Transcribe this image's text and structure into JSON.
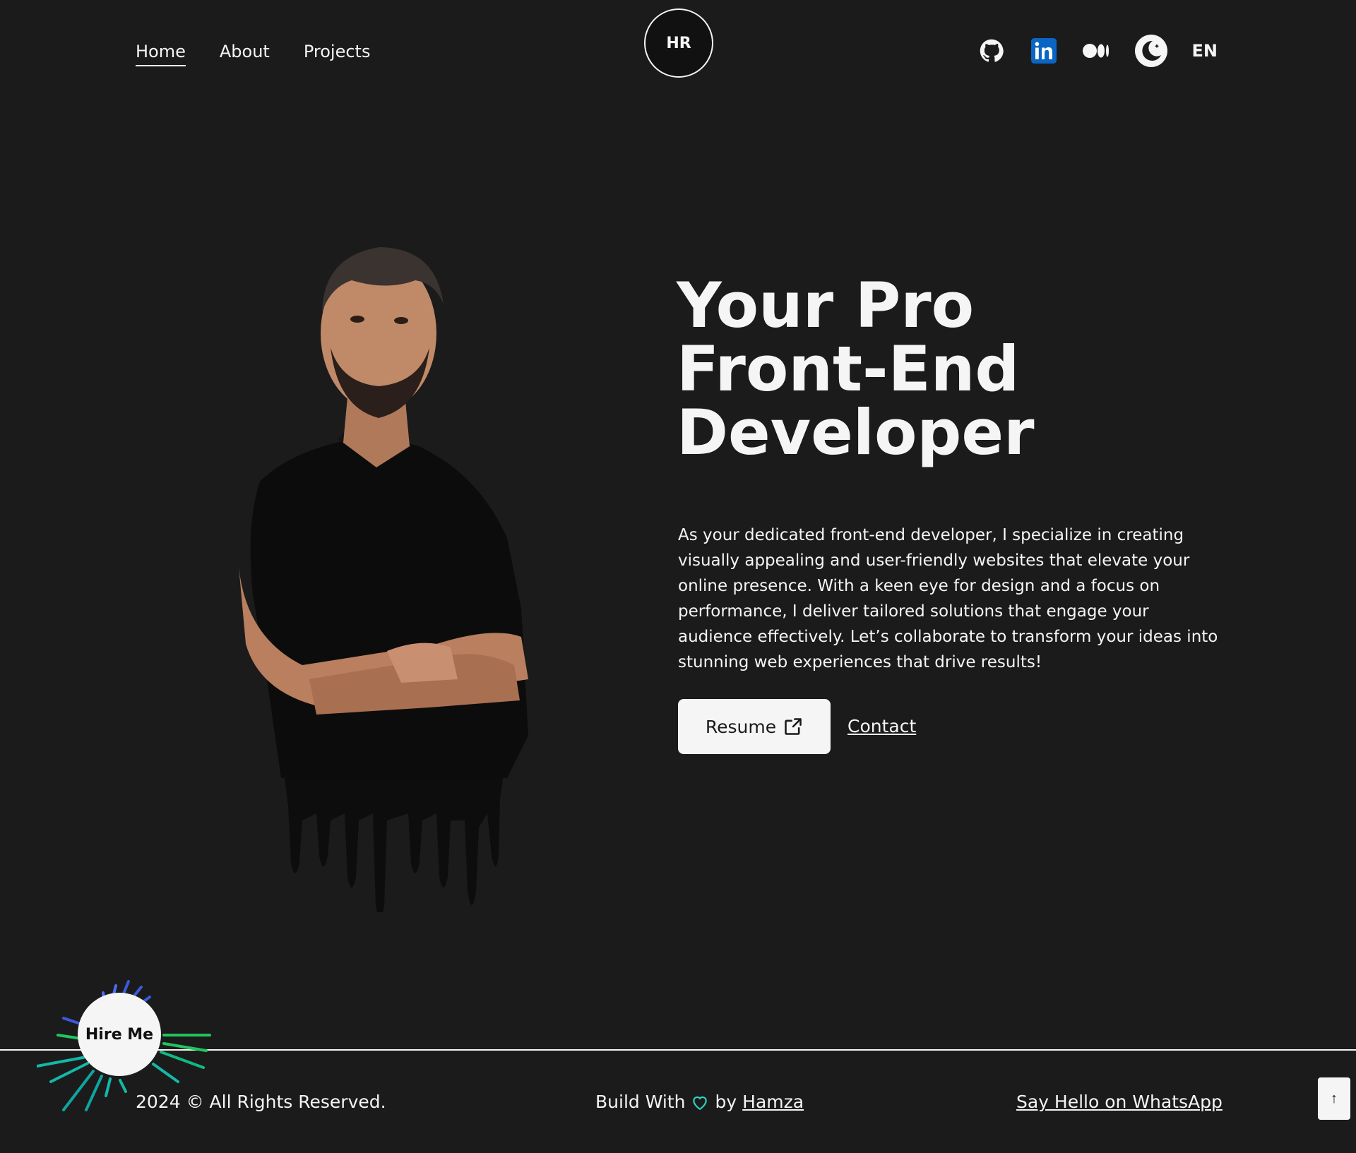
{
  "nav": {
    "items": [
      "Home",
      "About",
      "Projects"
    ],
    "active": "Home"
  },
  "logo": {
    "initials": "HR"
  },
  "header_right": {
    "socials": [
      "github-icon",
      "linkedin-icon",
      "medium-icon",
      "theme-toggle-icon"
    ],
    "language": "EN"
  },
  "hero": {
    "title_lines": [
      "Your Pro",
      "Front-End",
      "Developer"
    ],
    "description": "As your dedicated front-end developer, I specialize in creating visually appealing and user-friendly websites that elevate your online presence. With a keen eye for design and a focus on performance, I deliver tailored solutions that engage your audience effectively. Let’s collaborate to transform your ideas into stunning web experiences that drive results!",
    "resume_label": "Resume",
    "contact_label": "Contact"
  },
  "footer": {
    "copyright": "2024 © All Rights Reserved.",
    "build_prefix": "Build With",
    "build_by": "by",
    "author": "Hamza",
    "whatsapp_label": "Say Hello on WhatsApp",
    "hire_label": "Hire Me",
    "to_top_label": "↑"
  },
  "colors": {
    "background": "#1b1b1c",
    "foreground": "#f5f5f5",
    "linkedin": "#0a66c2",
    "heart": "#2dd4bf",
    "burst_blue": "#3b5bdb",
    "burst_green": "#22c55e",
    "burst_teal": "#14b8a6"
  }
}
